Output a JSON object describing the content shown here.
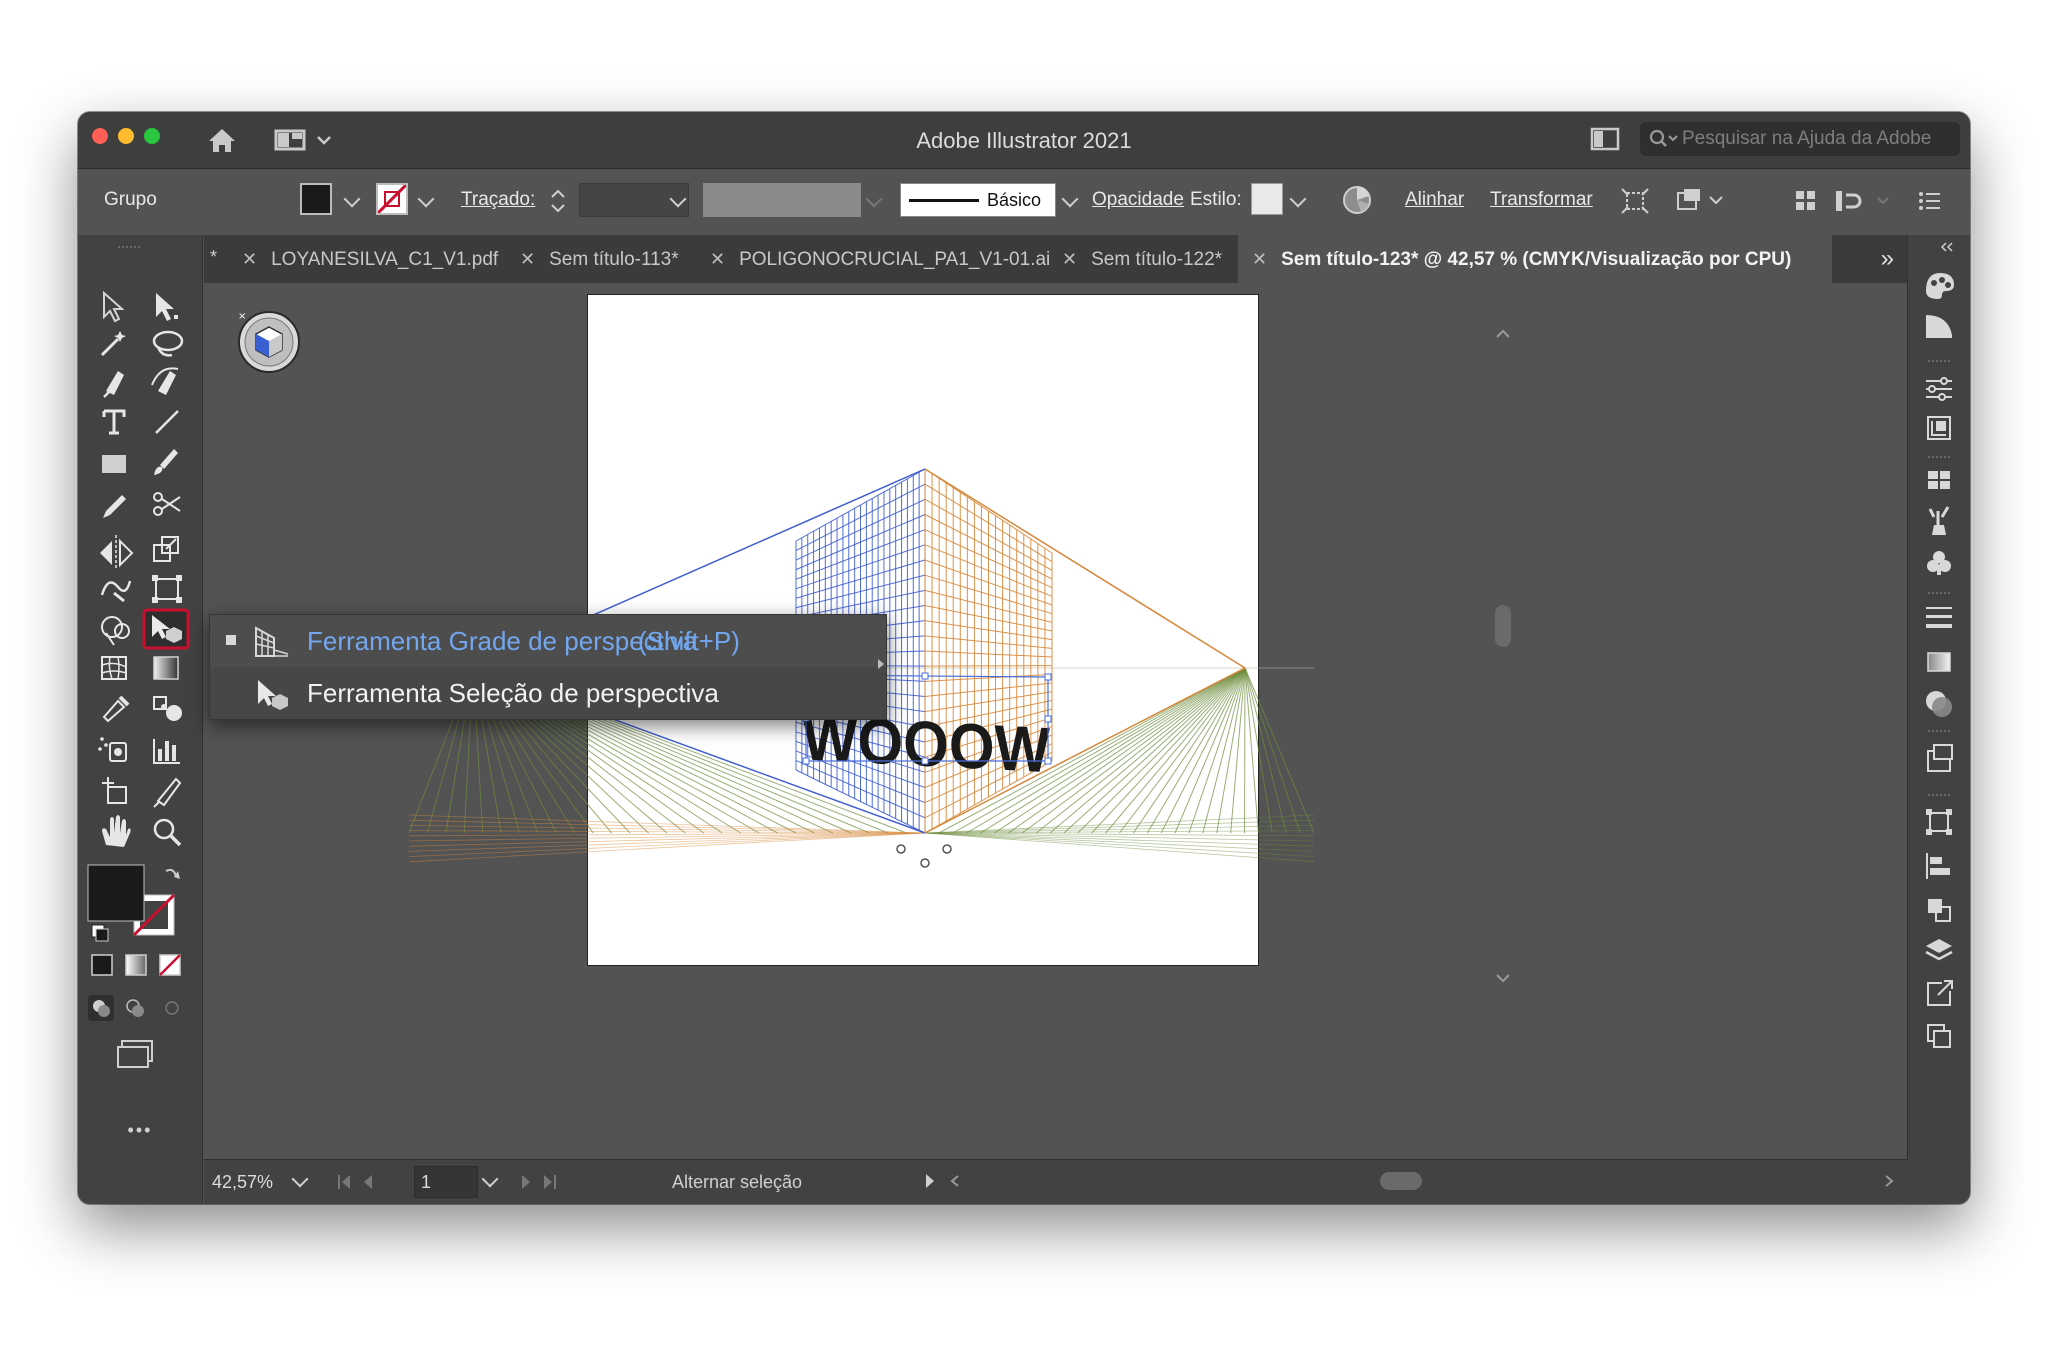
{
  "window": {
    "title": "Adobe Illustrator 2021"
  },
  "search": {
    "placeholder": "Pesquisar na Ajuda da Adobe"
  },
  "control_bar": {
    "selection_label": "Grupo",
    "stroke_label": "Traçado:",
    "brush_label": "Básico",
    "opacity_label": "Opacidade",
    "style_label": "Estilo:",
    "align_label": "Alinhar",
    "transform_label": "Transformar"
  },
  "tabs": [
    {
      "label": "LOYANESILVA_C1_V1.pdf"
    },
    {
      "label": "Sem título-113*"
    },
    {
      "label": "POLIGONOCRUCIAL_PA1_V1-01.ai"
    },
    {
      "label": "Sem título-122*"
    },
    {
      "label": "Sem título-123* @ 42,57 % (CMYK/Visualização por CPU)",
      "active": true
    }
  ],
  "tab_overflow": "»",
  "flyout": {
    "items": [
      {
        "label": "Ferramenta Grade de perspectiva",
        "shortcut": "(Shift+P)",
        "selected": true
      },
      {
        "label": "Ferramenta Seleção de perspectiva",
        "shortcut": ""
      }
    ]
  },
  "artwork": {
    "text": "WOOOW"
  },
  "status": {
    "zoom": "42,57%",
    "artboard": "1",
    "message": "Alternar seleção"
  },
  "colors": {
    "fill": "#1a1a1a",
    "accent": "#72a6ee",
    "grid_left": "#3f5fd0",
    "grid_right": "#d6883a",
    "grid_ground": "#6d8d3c",
    "highlight": "#c8102e"
  },
  "tools_more": "•••"
}
